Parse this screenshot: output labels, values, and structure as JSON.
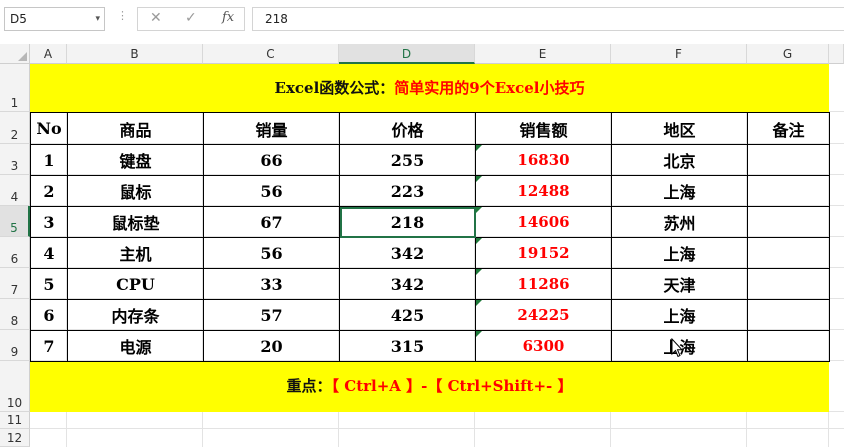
{
  "formula_bar": {
    "name_box": "D5",
    "dropdown_glyph": "▾",
    "dots": "⋮",
    "cancel_glyph": "✕",
    "enter_glyph": "✓",
    "fx_label": "fx",
    "formula_value": "218"
  },
  "columns": [
    "A",
    "B",
    "C",
    "D",
    "E",
    "F",
    "G"
  ],
  "rows": [
    "1",
    "2",
    "3",
    "4",
    "5",
    "6",
    "7",
    "8",
    "9",
    "10",
    "11",
    "12"
  ],
  "selected": {
    "column": "D",
    "row": "5"
  },
  "title": {
    "black": "Excel函数公式：",
    "red": "简单实用的9个Excel小技巧"
  },
  "table": {
    "headers": [
      "No",
      "商品",
      "销量",
      "价格",
      "销售额",
      "地区",
      "备注"
    ],
    "rows": [
      [
        "1",
        "键盘",
        "66",
        "255",
        "16830",
        "北京",
        ""
      ],
      [
        "2",
        "鼠标",
        "56",
        "223",
        "12488",
        "上海",
        ""
      ],
      [
        "3",
        "鼠标垫",
        "67",
        "218",
        "14606",
        "苏州",
        ""
      ],
      [
        "4",
        "主机",
        "56",
        "342",
        "19152",
        "上海",
        ""
      ],
      [
        "5",
        "CPU",
        "33",
        "342",
        "11286",
        "天津",
        ""
      ],
      [
        "6",
        "内存条",
        "57",
        "425",
        "24225",
        "上海",
        ""
      ],
      [
        "7",
        "电源",
        "20",
        "315",
        "6300",
        "上海",
        ""
      ]
    ]
  },
  "footer": {
    "black": "重点：",
    "red": "【 Ctrl+A 】-【 Ctrl+Shift+- 】"
  },
  "colors": {
    "highlight": "#ffff00",
    "accent_red": "#ff0000",
    "excel_green": "#217346"
  }
}
